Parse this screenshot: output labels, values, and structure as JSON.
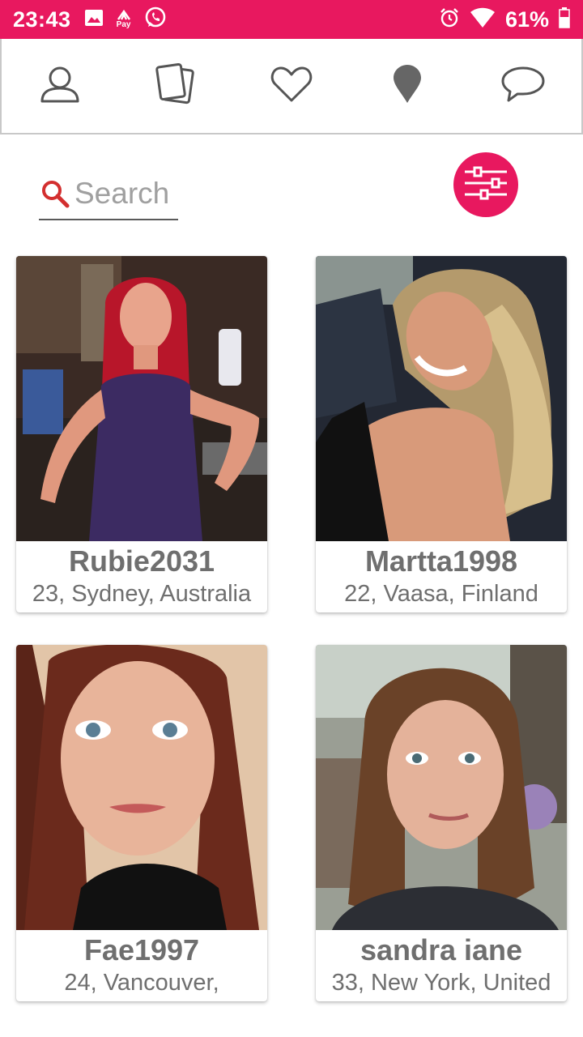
{
  "status_bar": {
    "time": "23:43",
    "battery_percent": "61%",
    "left_icons": [
      "image-icon",
      "pay-icon",
      "whatsapp-icon"
    ],
    "right_icons": [
      "alarm-icon",
      "wifi-icon",
      "battery-icon"
    ],
    "pay_label": "Pay"
  },
  "nav": {
    "items": [
      {
        "icon": "profile-icon"
      },
      {
        "icon": "cards-icon"
      },
      {
        "icon": "heart-icon"
      },
      {
        "icon": "location-pin-icon"
      },
      {
        "icon": "chat-icon"
      }
    ]
  },
  "search": {
    "placeholder": "Search"
  },
  "filter": {
    "icon": "filter-sliders-icon"
  },
  "colors": {
    "accent": "#e8185f",
    "text_gray": "#6f6f6f"
  },
  "profiles": [
    {
      "name": "Rubie2031",
      "info": "23, Sydney, Australia"
    },
    {
      "name": "Martta1998",
      "info": "22, Vaasa, Finland"
    },
    {
      "name": "Fae1997",
      "info": "24, Vancouver,"
    },
    {
      "name": "sandra iane",
      "info": "33, New York, United"
    }
  ]
}
